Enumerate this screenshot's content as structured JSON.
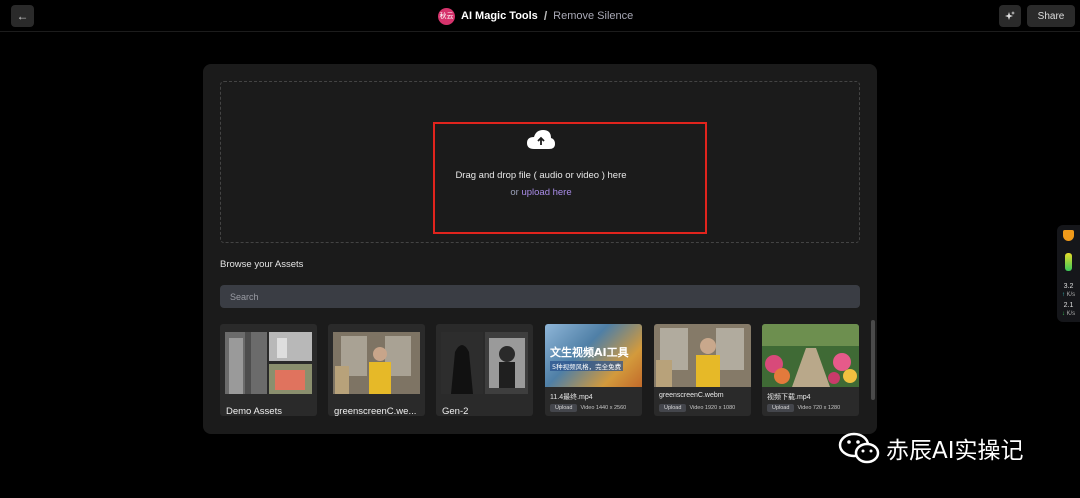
{
  "header": {
    "logo_text": "秋云",
    "app_name": "AI Magic Tools",
    "separator": "/",
    "page_name": "Remove Silence",
    "back_icon": "arrow-left-icon",
    "magic_icon": "sparkle-icon",
    "share_label": "Share"
  },
  "upload": {
    "icon": "cloud-upload-icon",
    "drop_text": "Drag and drop file ( audio or video ) here",
    "or_text": "or ",
    "link_text": "upload here"
  },
  "assets": {
    "title": "Browse your Assets",
    "search_placeholder": "Search",
    "folders": [
      {
        "label": "Demo Assets"
      },
      {
        "label": "greenscreenC.we..."
      },
      {
        "label": "Gen-2"
      }
    ],
    "files": [
      {
        "name": "11.4最终.mp4",
        "tag": "Upload",
        "meta": "Video 1440 x 2560",
        "thumb_text_1": "文生视频AI工具",
        "thumb_text_2": "5种视频风格，完全免费"
      },
      {
        "name": "greenscreenC.webm",
        "tag": "Upload",
        "meta": "Video 1920 x 1080"
      },
      {
        "name": "视频下载.mp4",
        "tag": "Upload",
        "meta": "Video 720 x 1280"
      }
    ]
  },
  "side_widget": {
    "upload_speed": "3.2",
    "upload_unit": "K/s",
    "download_speed": "2.1",
    "download_unit": "K/s"
  },
  "watermark": {
    "text": "赤辰AI实操记"
  },
  "colors": {
    "background": "#000000",
    "panel": "#1b1b1b",
    "accent_link": "#a98ce8",
    "annotation_red": "#e1241d"
  }
}
